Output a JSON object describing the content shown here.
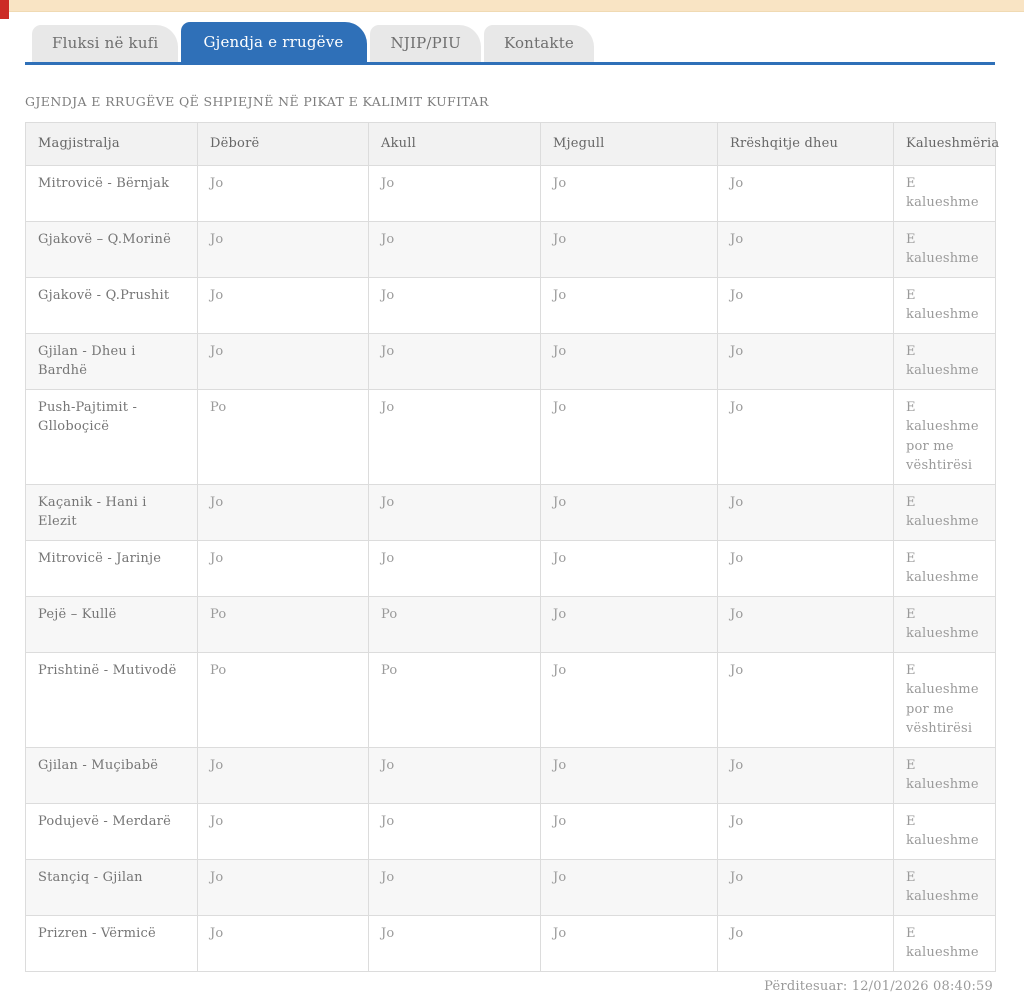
{
  "page": {
    "top_bar_color": "#f9e4c4",
    "accent_red": "#cc2b25",
    "accent_blue": "#2f70b8"
  },
  "tabs": [
    {
      "label": "Fluksi në kufi",
      "active": false
    },
    {
      "label": "Gjendja e rrugëve",
      "active": true
    },
    {
      "label": "NJIP/PIU",
      "active": false
    },
    {
      "label": "Kontakte",
      "active": false
    }
  ],
  "heading": "GJENDJA E RRUGËVE QË SHPIEJNË NË PIKAT E KALIMIT KUFITAR",
  "table": {
    "columns": [
      "Magjistralja",
      "Dëborë",
      "Akull",
      "Mjegull",
      "Rrëshqitje dheu",
      "Kalueshmëria"
    ],
    "rows": [
      [
        "Mitrovicë - Bërnjak",
        "Jo",
        "Jo",
        "Jo",
        "Jo",
        "E kalueshme"
      ],
      [
        "Gjakovë – Q.Morinë",
        "Jo",
        "Jo",
        "Jo",
        "Jo",
        "E kalueshme"
      ],
      [
        "Gjakovë - Q.Prushit",
        "Jo",
        "Jo",
        "Jo",
        "Jo",
        "E kalueshme"
      ],
      [
        "Gjilan - Dheu i Bardhë",
        "Jo",
        "Jo",
        "Jo",
        "Jo",
        "E kalueshme"
      ],
      [
        "Push-Pajtimit - Glloboçicë",
        "Po",
        "Jo",
        "Jo",
        "Jo",
        "E kalueshme por me vështirësi"
      ],
      [
        "Kaçanik - Hani i Elezit",
        "Jo",
        "Jo",
        "Jo",
        "Jo",
        "E kalueshme"
      ],
      [
        "Mitrovicë - Jarinje",
        "Jo",
        "Jo",
        "Jo",
        "Jo",
        "E kalueshme"
      ],
      [
        "Pejë – Kullë",
        "Po",
        "Po",
        "Jo",
        "Jo",
        "E kalueshme"
      ],
      [
        "Prishtinë - Mutivodë",
        "Po",
        "Po",
        "Jo",
        "Jo",
        "E kalueshme por me vështirësi"
      ],
      [
        "Gjilan - Muçibabë",
        "Jo",
        "Jo",
        "Jo",
        "Jo",
        "E kalueshme"
      ],
      [
        "Podujevë - Merdarë",
        "Jo",
        "Jo",
        "Jo",
        "Jo",
        "E kalueshme"
      ],
      [
        "Stançiq - Gjilan",
        "Jo",
        "Jo",
        "Jo",
        "Jo",
        "E kalueshme"
      ],
      [
        "Prizren - Vërmicë",
        "Jo",
        "Jo",
        "Jo",
        "Jo",
        "E kalueshme"
      ]
    ]
  },
  "footer": {
    "updated_label": "Përditesuar: 12/01/2026 08:40:59"
  }
}
